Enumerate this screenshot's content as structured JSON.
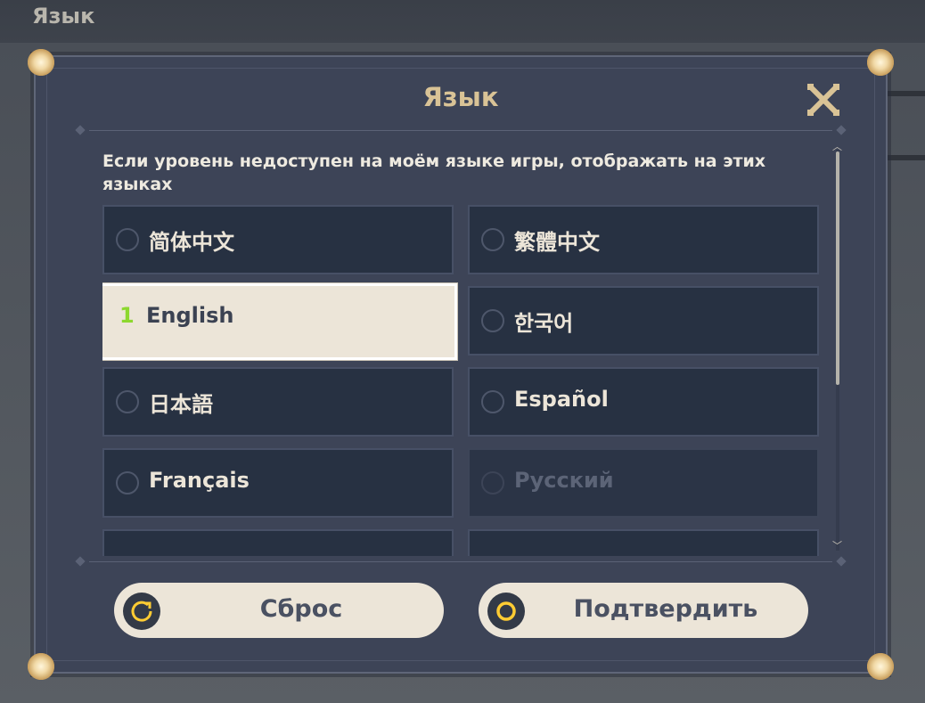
{
  "background": {
    "title": "Язык"
  },
  "dialog": {
    "title": "Язык",
    "description": "Если уровень недоступен на моём языке игры, отображать на этих языках",
    "languages": [
      {
        "label": "简体中文",
        "state": "unselected"
      },
      {
        "label": "繁體中文",
        "state": "unselected"
      },
      {
        "label": "English",
        "state": "selected",
        "order": "1"
      },
      {
        "label": "한국어",
        "state": "unselected"
      },
      {
        "label": "日本語",
        "state": "unselected"
      },
      {
        "label": "Español",
        "state": "unselected"
      },
      {
        "label": "Français",
        "state": "unselected"
      },
      {
        "label": "Русский",
        "state": "disabled"
      }
    ],
    "buttons": {
      "reset_label": "Сброс",
      "confirm_label": "Подтвердить"
    }
  },
  "icons": {
    "close": "close-x-icon",
    "reset": "reset-arrow-icon",
    "confirm": "confirm-ring-icon",
    "radio": "radio-circle-icon"
  },
  "colors": {
    "dialog_bg": "#3d4457",
    "title_gold": "#d9c396",
    "option_bg": "#273142",
    "selected_bg": "#ece5d8",
    "order_green": "#8dd82f",
    "icon_yellow": "#ffcc33"
  }
}
